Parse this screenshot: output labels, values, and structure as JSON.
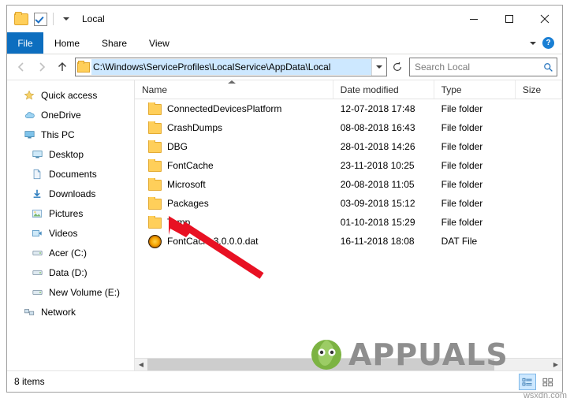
{
  "window": {
    "title": "Local",
    "quick_access": [
      "folder-icon",
      "properties-checkbox-icon",
      "dropdown-chevron-icon"
    ],
    "controls": {
      "minimize": "Minimize",
      "maximize": "Maximize",
      "close": "Close"
    }
  },
  "ribbon": {
    "file_tab": "File",
    "tabs": [
      "Home",
      "Share",
      "View"
    ],
    "expand_label": "chevron-down-icon",
    "help_label": "?"
  },
  "address": {
    "back": "back-arrow-icon",
    "forward": "forward-arrow-icon",
    "up": "up-arrow-icon",
    "path": "C:\\Windows\\ServiceProfiles\\LocalService\\AppData\\Local",
    "refresh": "refresh-icon",
    "search_placeholder": "Search Local"
  },
  "nav_pane": {
    "items": [
      {
        "label": "Quick access",
        "icon": "star-icon",
        "indent": false
      },
      {
        "label": "OneDrive",
        "icon": "cloud-icon",
        "indent": false
      },
      {
        "label": "This PC",
        "icon": "monitor-icon",
        "indent": false
      },
      {
        "label": "Desktop",
        "icon": "desktop-icon",
        "indent": true
      },
      {
        "label": "Documents",
        "icon": "documents-icon",
        "indent": true
      },
      {
        "label": "Downloads",
        "icon": "downloads-icon",
        "indent": true
      },
      {
        "label": "Pictures",
        "icon": "pictures-icon",
        "indent": true
      },
      {
        "label": "Videos",
        "icon": "videos-icon",
        "indent": true
      },
      {
        "label": "Acer (C:)",
        "icon": "drive-icon",
        "indent": true
      },
      {
        "label": "Data (D:)",
        "icon": "drive-icon",
        "indent": true
      },
      {
        "label": "New Volume (E:)",
        "icon": "drive-icon",
        "indent": true
      },
      {
        "label": "Network",
        "icon": "network-icon",
        "indent": false
      }
    ]
  },
  "file_list": {
    "columns": [
      "Name",
      "Date modified",
      "Type",
      "Size"
    ],
    "sorted_by": "Name",
    "rows": [
      {
        "name": "ConnectedDevicesPlatform",
        "date": "12-07-2018 17:48",
        "type": "File folder",
        "size": "",
        "icon": "folder-icon"
      },
      {
        "name": "CrashDumps",
        "date": "08-08-2018 16:43",
        "type": "File folder",
        "size": "",
        "icon": "folder-icon"
      },
      {
        "name": "DBG",
        "date": "28-01-2018 14:26",
        "type": "File folder",
        "size": "",
        "icon": "folder-icon"
      },
      {
        "name": "FontCache",
        "date": "23-11-2018 10:25",
        "type": "File folder",
        "size": "",
        "icon": "folder-icon"
      },
      {
        "name": "Microsoft",
        "date": "20-08-2018 11:05",
        "type": "File folder",
        "size": "",
        "icon": "folder-icon"
      },
      {
        "name": "Packages",
        "date": "03-09-2018 15:12",
        "type": "File folder",
        "size": "",
        "icon": "folder-icon"
      },
      {
        "name": "Temp",
        "date": "01-10-2018 15:29",
        "type": "File folder",
        "size": "",
        "icon": "folder-icon"
      },
      {
        "name": "FontCache3.0.0.0.dat",
        "date": "16-11-2018 18:08",
        "type": "DAT File",
        "size": "",
        "icon": "dat-file-icon"
      }
    ]
  },
  "status": {
    "item_count": "8 items",
    "view_details": "details-view-icon",
    "view_large": "large-icons-view-icon"
  },
  "annotations": {
    "arrow_color": "#e81123",
    "watermark": "APPUALS",
    "corner_text": "wsxdn.com"
  }
}
